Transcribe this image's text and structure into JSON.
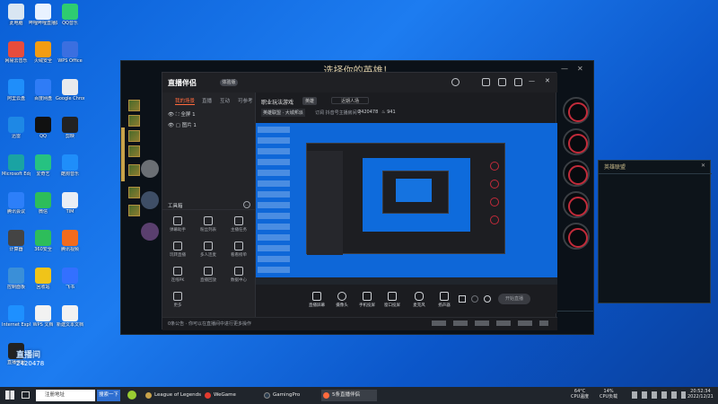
{
  "desktop": {
    "icons": [
      {
        "label": "此电脑",
        "color": "#d9e6f2"
      },
      {
        "label": "哔哩哔哩直播姬",
        "color": "#e9f2ff"
      },
      {
        "label": "QQ音乐",
        "color": "#2ecc71"
      },
      {
        "label": "网易云音乐",
        "color": "#e74c3c"
      },
      {
        "label": "火绒安全",
        "color": "#f39c12"
      },
      {
        "label": "WPS Office",
        "color": "#3b6fe0"
      },
      {
        "label": "阿里云盘",
        "color": "#1f8efa"
      },
      {
        "label": "百度网盘",
        "color": "#2f7cf6"
      },
      {
        "label": "Google Chrome",
        "color": "#e8eaed"
      },
      {
        "label": "迅雷",
        "color": "#1e88e5"
      },
      {
        "label": "QQ",
        "color": "#111"
      },
      {
        "label": "剪映",
        "color": "#222"
      },
      {
        "label": "Microsoft Edge",
        "color": "#1aa3a3"
      },
      {
        "label": "爱奇艺",
        "color": "#26c281"
      },
      {
        "label": "酷狗音乐",
        "color": "#1f8efa"
      },
      {
        "label": "腾讯会议",
        "color": "#2d7ff9"
      },
      {
        "label": "微信",
        "color": "#2dbd5a"
      },
      {
        "label": "TIM",
        "color": "#e9eef5"
      },
      {
        "label": "计算器",
        "color": "#444"
      },
      {
        "label": "360安全",
        "color": "#2dbd5a"
      },
      {
        "label": "腾讯视频",
        "color": "#f26b1d"
      },
      {
        "label": "控制面板",
        "color": "#3a8fd8"
      },
      {
        "label": "回收站",
        "color": "#f0c419"
      },
      {
        "label": "飞书",
        "color": "#3370ff"
      },
      {
        "label": "Internet Explorer",
        "color": "#1e90ff"
      },
      {
        "label": "WPS 文档",
        "color": "#f2f2f2"
      },
      {
        "label": "新建文本文档",
        "color": "#f2f2f2"
      },
      {
        "label": "直播伴侣",
        "color": "#222"
      }
    ]
  },
  "overlay": {
    "line1": "直播间",
    "line2": "2420478"
  },
  "lol": {
    "title": "选择你的英雄！",
    "small_title": "英雄联盟"
  },
  "app": {
    "logo": "直播伴侣",
    "badge": "体验版",
    "tabs": [
      "我的场景",
      "直播",
      "互动",
      "可参考"
    ],
    "scenes": [
      "全屏 1",
      "图片 1"
    ],
    "toolbox_label": "工具箱",
    "tools": [
      [
        "弹幕助手",
        "粉丝列表",
        "主播任务"
      ],
      [
        "玩转直播",
        "多人连麦",
        "看看榜单"
      ],
      [
        "连线PK",
        "直播回放",
        "数据中心"
      ],
      [
        "更多"
      ]
    ],
    "stream_title": "职业玩法游戏",
    "stream_tag": "英雄",
    "stream_edit": "近期人场",
    "category": "英雄联盟 · 大城邦派",
    "room_text": "订阅 抖音号主播房间号",
    "room_id": "2420478",
    "online": "941",
    "controls": [
      "直播屏幕",
      "摄像头",
      "手机投屏",
      "窗口投屏",
      "麦克风",
      "扬声器"
    ],
    "start_label": "开始直播",
    "status_text": "0条公告 · 你可以在直播间中进行更多操作"
  },
  "taskbar": {
    "search_placeholder": "注册地址",
    "search_go": "搜索一下",
    "apps": [
      {
        "label": "League of Legends",
        "color": "#c8a24a"
      },
      {
        "label": "WeGame",
        "color": "#e23b2f"
      },
      {
        "label": "GamingPro",
        "color": "#2c3e50"
      },
      {
        "label": "5条直播伴侣",
        "color": "#ff6a3d"
      }
    ],
    "temp": "64°C",
    "temp_label": "CPU温度",
    "cpu": "14%",
    "cpu_label": "CPU负载",
    "time": "20:52:34",
    "date": "2022/12/21"
  }
}
